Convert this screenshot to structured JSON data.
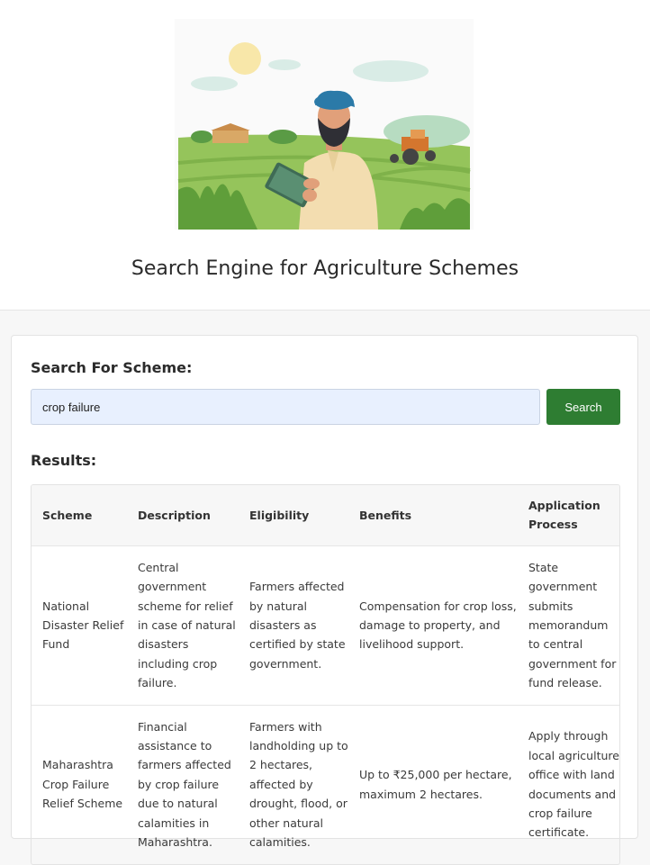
{
  "header": {
    "title": "Search Engine for Agriculture Schemes",
    "illustration": "farmer-with-tablet-in-field-illustration"
  },
  "search": {
    "label": "Search For Scheme:",
    "value": "crop failure",
    "placeholder": "",
    "button_label": "Search"
  },
  "results": {
    "label": "Results:",
    "columns": [
      "Scheme",
      "Description",
      "Eligibility",
      "Benefits",
      "Application Process"
    ],
    "rows": [
      {
        "scheme": "National Disaster Relief Fund",
        "description": "Central government scheme for relief in case of natural disasters including crop failure.",
        "eligibility": "Farmers affected by natural disasters as certified by state government.",
        "benefits": "Compensation for crop loss, damage to property, and livelihood support.",
        "application": "State government submits memorandum to central government for fund release."
      },
      {
        "scheme": "Maharashtra Crop Failure Relief Scheme",
        "description": "Financial assistance to farmers affected by crop failure due to natural calamities in Maharashtra.",
        "eligibility": "Farmers with landholding up to 2 hectares, affected by drought, flood, or other natural calamities.",
        "benefits": "Up to ₹25,000 per hectare, maximum 2 hectares.",
        "application": "Apply through local agriculture office with land documents and crop failure certificate."
      }
    ]
  },
  "colors": {
    "accent": "#2e7d32",
    "input_bg": "#e8f0fe"
  }
}
